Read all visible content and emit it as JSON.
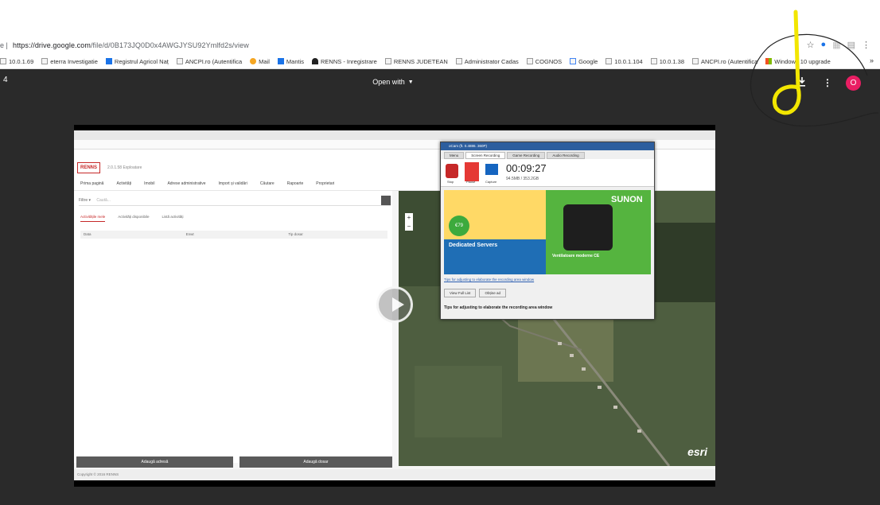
{
  "browser": {
    "url_prefix": "e |",
    "url_host": "https://drive.google.com",
    "url_path": "/file/d/0B173JQ0D0x4AWGJYSU92Ymlfd2s/view",
    "more_label": "»"
  },
  "bookmarks": [
    {
      "label": "10.0.1.69",
      "icon": "page-icon"
    },
    {
      "label": "eterra Investigatie",
      "icon": "page-icon"
    },
    {
      "label": "Registrul Agricol Naț",
      "icon": "registry-icon"
    },
    {
      "label": "ANCPI.ro (Autentifica",
      "icon": "ancpi-icon"
    },
    {
      "label": "Mail",
      "icon": "mail-icon"
    },
    {
      "label": "Mantis",
      "icon": "mantis-icon"
    },
    {
      "label": "RENNS - Inregistrare",
      "icon": "user-icon"
    },
    {
      "label": "RENNS JUDETEAN",
      "icon": "ancpi-icon"
    },
    {
      "label": "Administrator Cadas",
      "icon": "page-icon"
    },
    {
      "label": "COGNOS",
      "icon": "page-icon"
    },
    {
      "label": "Google",
      "icon": "google-icon"
    },
    {
      "label": "10.0.1.104",
      "icon": "page-icon"
    },
    {
      "label": "10.0.1.38",
      "icon": "page-icon"
    },
    {
      "label": "ANCPI.ro (Autentifica",
      "icon": "ancpi-icon"
    },
    {
      "label": "Windows 10 upgrade",
      "icon": "windows-icon"
    }
  ],
  "viewer": {
    "page_num": "4",
    "open_with_label": "Open with",
    "avatar_letter": "O",
    "avatar_color": "#e91e63"
  },
  "video": {
    "app_logo": "RENNS",
    "app_version": "2.0.1.58 Exploatare",
    "nav": [
      "Prima pagină",
      "Activități",
      "Imobil",
      "Adrese administrative",
      "Import și validări",
      "Căutare",
      "Rapoarte",
      "Proprietari"
    ],
    "filter_label": "Filtre ▾",
    "filter_placeholder": "Caută...",
    "subtabs": [
      "Activitățile mele",
      "Activități disponibile",
      "Listă activități"
    ],
    "table_headers": [
      "Data",
      "Enwt",
      "Tip dosar"
    ],
    "btn_left": "Adaugă adresă",
    "btn_right": "Adaugă dosar",
    "footer": "Copyright © 2016 RENNS",
    "esri": "esri",
    "recorder": {
      "title": "oCam (ft. 0.4886. 360P)",
      "tabs": [
        "Menu",
        "Screen Recording",
        "Game Recording",
        "Audio Recording"
      ],
      "stop_label": "Stop",
      "pause_label": "Pause",
      "capture_label": "Capture",
      "time": "00:09:27",
      "size": "94.5MB / 353.2GB",
      "ad_dedicated": "Dedicated Servers",
      "ad_price": "€79",
      "ad_sunon": "SUNON",
      "ad_vent": "Ventilatoare moderne CE",
      "link": "Tips for adjusting to elaborate the recording area window",
      "btn_view": "View Full List",
      "btn_ok": "Obține ad",
      "tip": "Tips for adjusting to elaborate the recording area window"
    }
  },
  "colors": {
    "viewer_bg": "#2a2a2a",
    "brand_red": "#c62828",
    "annotation_yellow": "#f2e600"
  }
}
